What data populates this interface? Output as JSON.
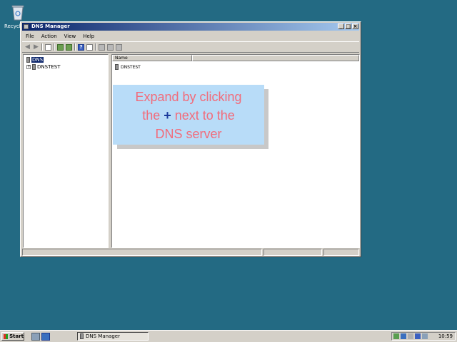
{
  "desktop": {
    "recycle_label": "Recycle"
  },
  "window": {
    "title": "DNS Manager",
    "menu": [
      "File",
      "Action",
      "View",
      "Help"
    ]
  },
  "tree": {
    "root": "DNS",
    "server": "DNSTEST"
  },
  "list": {
    "columns": [
      "Name"
    ],
    "rows": [
      "DNSTEST"
    ]
  },
  "callout": {
    "line1": "Expand by clicking",
    "line2_before": "the ",
    "line2_plus": "+",
    "line2_after": " next to the",
    "line3": "DNS server"
  },
  "taskbar": {
    "start_label": "Start",
    "task_label": "DNS Manager",
    "clock": "10:59"
  },
  "colors": {
    "desktop": "#236a83",
    "callout_bg": "#b8dcf8",
    "callout_text": "#f26b7a",
    "selection": "#0a246a"
  }
}
